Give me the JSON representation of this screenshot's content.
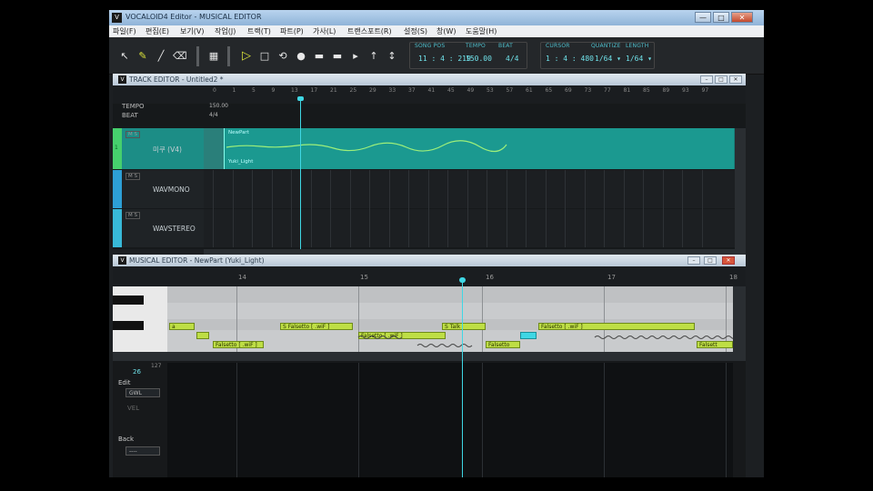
{
  "window": {
    "title": "VOCALOID4 Editor - MUSICAL EDITOR",
    "min": "—",
    "max": "□",
    "close": "✕",
    "app_icon": "V"
  },
  "menu": [
    {
      "label": "파일(F)"
    },
    {
      "label": "편집(E)"
    },
    {
      "label": "보기(V)"
    },
    {
      "label": "작업(J)"
    },
    {
      "label": "트랙(T)"
    },
    {
      "label": "파트(P)"
    },
    {
      "label": "가사(L)"
    },
    {
      "label": "트랜스포트(R)"
    },
    {
      "label": "설정(S)"
    },
    {
      "label": "창(W)"
    },
    {
      "label": "도움말(H)"
    }
  ],
  "toolbar": {
    "icons": [
      "arrow-tool-icon",
      "pencil-tool-icon",
      "line-tool-icon",
      "eraser-tool-icon",
      "grid-icon",
      "play-icon",
      "stop-icon",
      "loop-icon",
      "record-icon",
      "rewind-icon",
      "back-icon",
      "forward-icon",
      "end-icon",
      "pitch-icon"
    ],
    "song_pos_label": "SONG POS",
    "song_pos_value": "11 : 4 : 219",
    "tempo_label": "TEMPO",
    "tempo_value": "150.00",
    "beat_label": "BEAT",
    "beat_value": "4/4",
    "cursor_label": "CURSOR",
    "cursor_value": "1 : 4 : 480",
    "quantize_label": "QUANTIZE",
    "quantize_value": "1/64 ▾",
    "length_label": "LENGTH",
    "length_value": "1/64 ▾"
  },
  "track_editor": {
    "title": "TRACK EDITOR - Untitled2 *",
    "tempo_label": "TEMPO",
    "beat_label": "BEAT",
    "tempo_value": "150.00",
    "beat_value": "4/4",
    "ruler": [
      "0",
      "1",
      "5",
      "9",
      "13",
      "17",
      "21",
      "25",
      "29",
      "33",
      "37",
      "41",
      "45",
      "49",
      "53",
      "57",
      "61",
      "65",
      "69",
      "73",
      "77",
      "81",
      "85",
      "89",
      "93",
      "97"
    ],
    "tracks": [
      {
        "num": "1",
        "name": "미쿠 (V4)",
        "part_name": "NewPart",
        "part_sub": "Yuki_Light",
        "color": "#2fb4a8"
      },
      {
        "num": "2",
        "name": "WAVMONO",
        "color": "#2d9fd6"
      },
      {
        "num": "3",
        "name": "WAVSTEREO",
        "color": "#38b9d8"
      }
    ]
  },
  "musical_editor": {
    "title": "MUSICAL EDITOR - NewPart (Yuki_Light)",
    "measures": [
      "14",
      "15",
      "16",
      "17",
      "18"
    ],
    "notes": [
      {
        "text": "a",
        "color": "green"
      },
      {
        "text": "",
        "color": "green"
      },
      {
        "text": "Falsetto [ .wiF ]",
        "color": "green"
      },
      {
        "text": "S  Falsetto [ .wiF ]",
        "color": "green"
      },
      {
        "text": "Falsetto [ .wiF ]",
        "color": "green"
      },
      {
        "text": "S  Talk",
        "color": "green"
      },
      {
        "text": "Falsetto",
        "color": "green"
      },
      {
        "text": "",
        "color": "cyan"
      },
      {
        "text": "Falsetto [ .wiF ]",
        "color": "green"
      },
      {
        "text": "Falsett",
        "color": "green"
      }
    ],
    "side": {
      "num": "127",
      "ratio": "26",
      "edit_label": "Edit",
      "edit_value": "GWL",
      "edit_sub": "VEL",
      "back_label": "Back",
      "back_value": "----"
    }
  },
  "colors": {
    "accent": "#3fd7e4",
    "note": "#bede45",
    "part": "#1b8f88"
  }
}
